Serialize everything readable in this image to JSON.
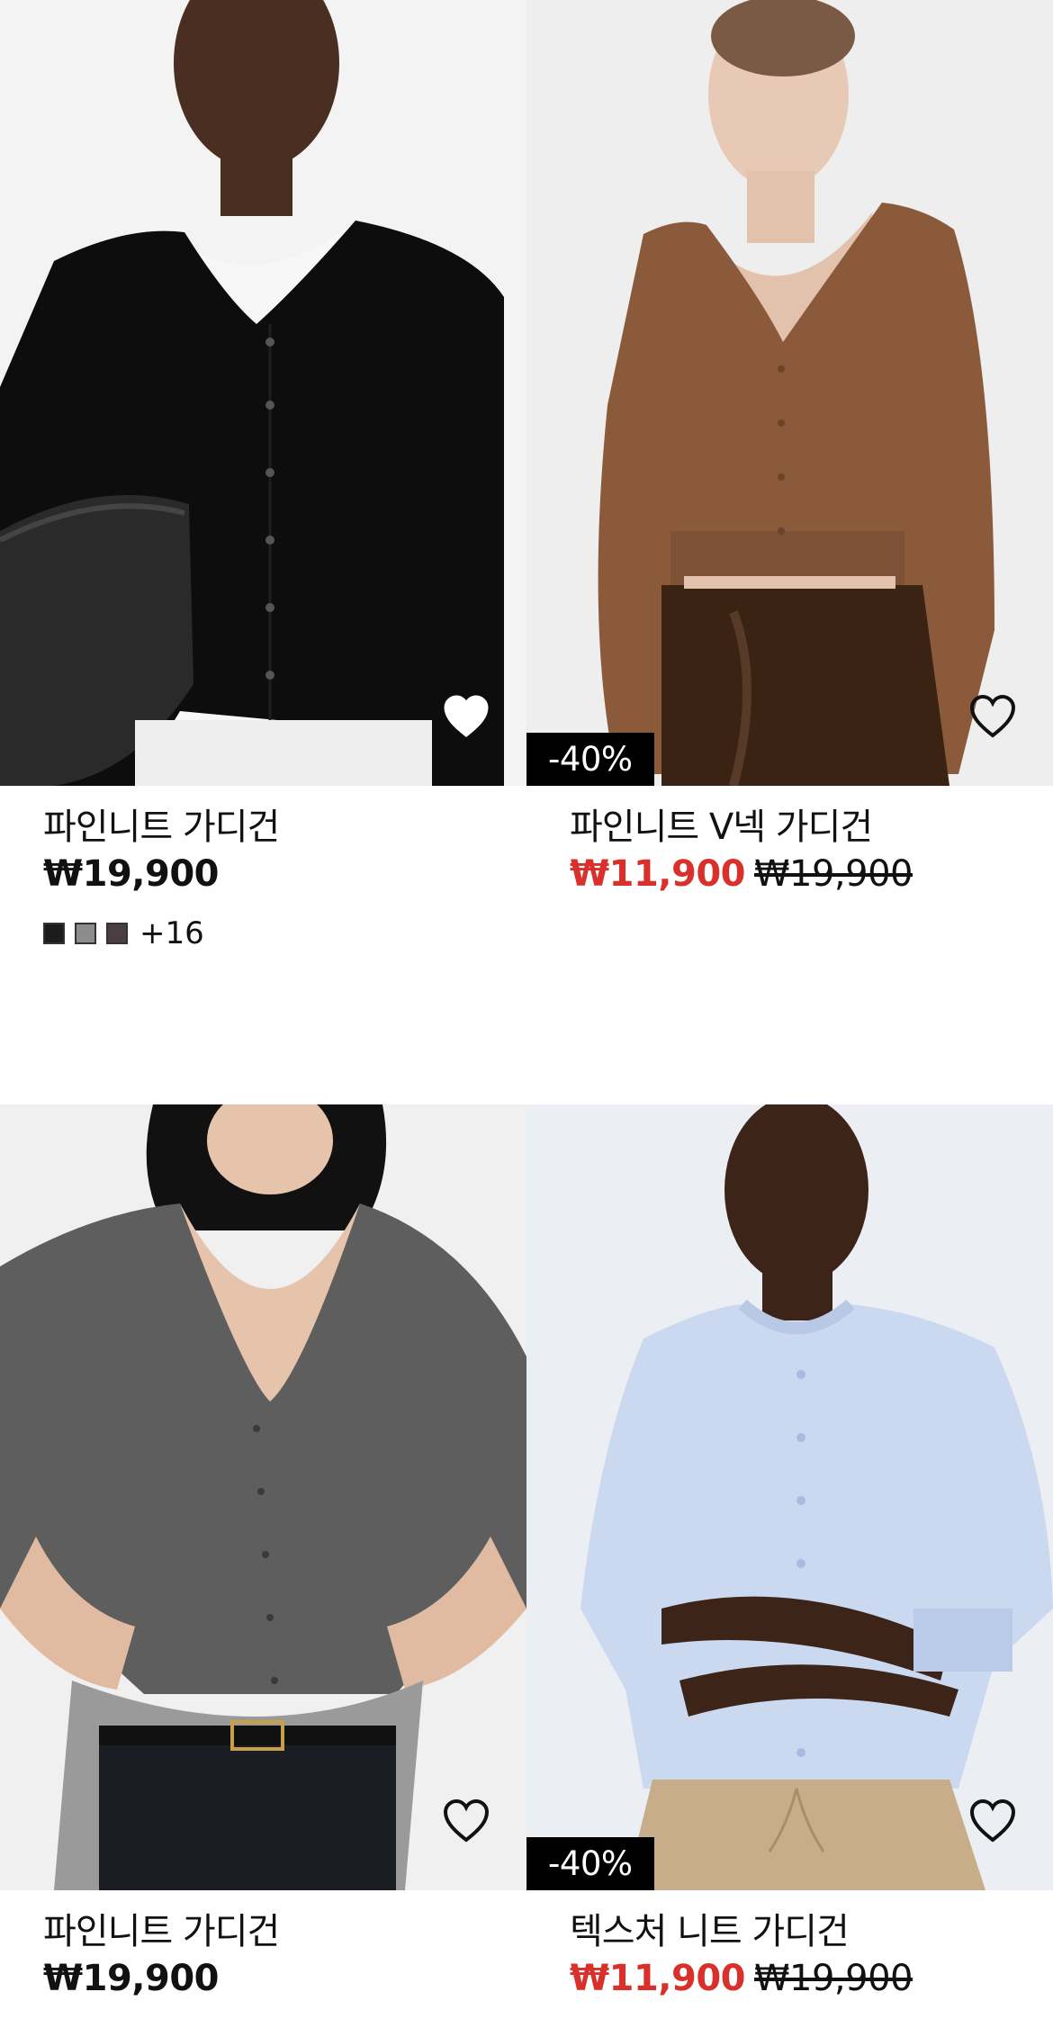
{
  "products": [
    {
      "name": "파인니트 가디건",
      "price": "₩19,900",
      "original_price": "",
      "discount": "",
      "favorited": true,
      "swatches": [
        "#1c1c1c",
        "#8c8c8c",
        "#4a3d44"
      ],
      "more_colors": "+16",
      "garment_color": "#0d0d0d",
      "background_color": "#f3f3f3"
    },
    {
      "name": "파인니트 V넥 가디건",
      "price": "₩11,900",
      "original_price": "₩19,900",
      "discount": "-40%",
      "favorited": false,
      "garment_color": "#8a5a3b",
      "background_color": "#eeeeee"
    },
    {
      "name": "파인니트 가디건",
      "price": "₩19,900",
      "original_price": "",
      "discount": "",
      "favorited": false,
      "garment_color": "#5e5e5e",
      "background_color": "#f0f0f0"
    },
    {
      "name": "텍스처 니트 가디건",
      "price": "₩11,900",
      "original_price": "₩19,900",
      "discount": "-40%",
      "favorited": false,
      "garment_color": "#cbd9f0",
      "background_color": "#ebeef3"
    }
  ],
  "colors": {
    "sale_price": "#d9302b",
    "discount_badge_bg": "#000000",
    "text": "#111111"
  },
  "icons": {
    "favorite": "heart-icon"
  }
}
